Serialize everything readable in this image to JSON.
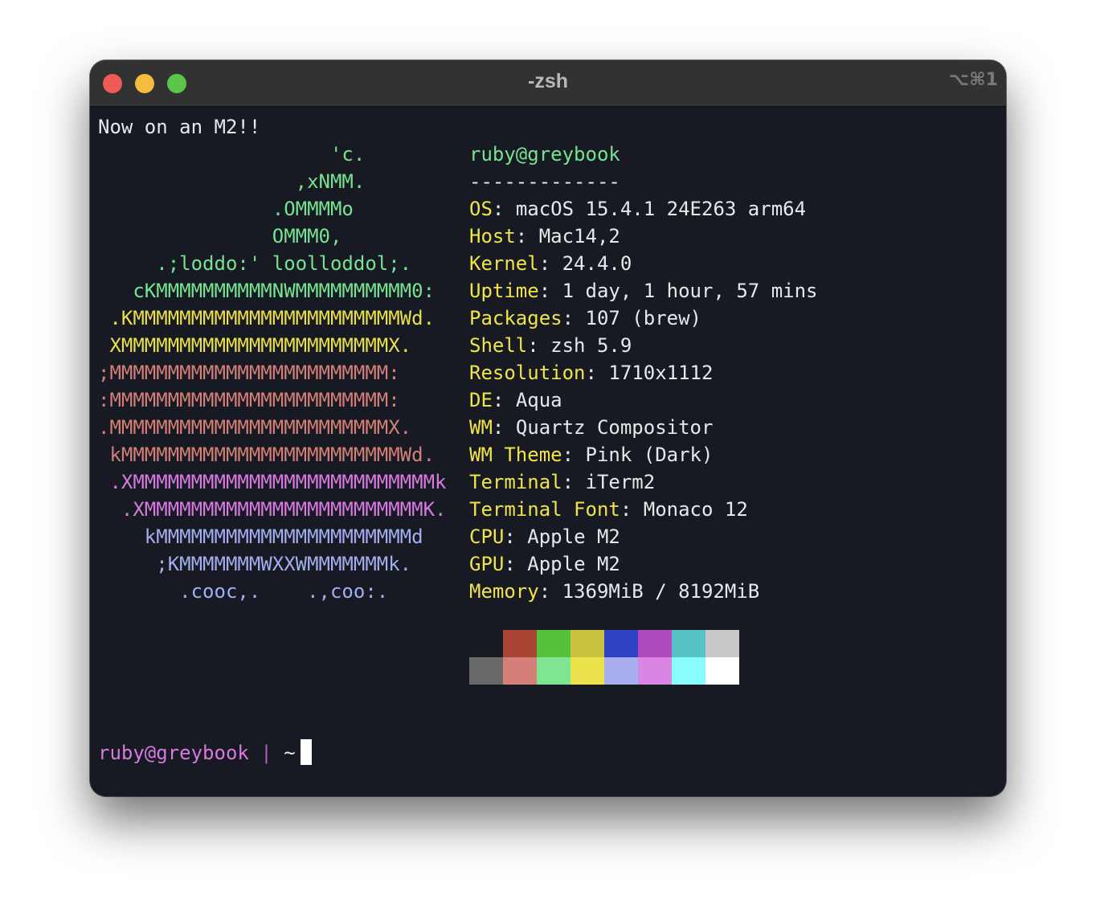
{
  "window": {
    "title": "-zsh",
    "shortcut": "⌥⌘1"
  },
  "motd": "Now on an M2!!",
  "logo": [
    {
      "text": "                    'c.",
      "color": "green"
    },
    {
      "text": "                 ,xNMM.",
      "color": "green"
    },
    {
      "text": "               .OMMMMo",
      "color": "green"
    },
    {
      "text": "               OMMM0,",
      "color": "green"
    },
    {
      "text": "     .;loddo:' loolloddol;.",
      "color": "green"
    },
    {
      "text": "   cKMMMMMMMMMMNWMMMMMMMMMM0:",
      "color": "green"
    },
    {
      "text": " .KMMMMMMMMMMMMMMMMMMMMMMMWd.",
      "color": "yellow"
    },
    {
      "text": " XMMMMMMMMMMMMMMMMMMMMMMMX.",
      "color": "yellow"
    },
    {
      "text": ";MMMMMMMMMMMMMMMMMMMMMMMM:",
      "color": "red"
    },
    {
      "text": ":MMMMMMMMMMMMMMMMMMMMMMMM:",
      "color": "red"
    },
    {
      "text": ".MMMMMMMMMMMMMMMMMMMMMMMMX.",
      "color": "red"
    },
    {
      "text": " kMMMMMMMMMMMMMMMMMMMMMMMMWd.",
      "color": "red"
    },
    {
      "text": " .XMMMMMMMMMMMMMMMMMMMMMMMMMMk",
      "color": "magenta"
    },
    {
      "text": "  .XMMMMMMMMMMMMMMMMMMMMMMMMK.",
      "color": "magenta"
    },
    {
      "text": "    kMMMMMMMMMMMMMMMMMMMMMMd",
      "color": "blue"
    },
    {
      "text": "     ;KMMMMMMMWXXWMMMMMMMk.",
      "color": "blue"
    },
    {
      "text": "       .cooc,.    .,coo:.",
      "color": "blue"
    }
  ],
  "info": {
    "user_host": "ruby@greybook",
    "divider": "-------------",
    "fields": [
      {
        "key": "OS",
        "value": "macOS 15.4.1 24E263 arm64"
      },
      {
        "key": "Host",
        "value": "Mac14,2"
      },
      {
        "key": "Kernel",
        "value": "24.4.0"
      },
      {
        "key": "Uptime",
        "value": "1 day, 1 hour, 57 mins"
      },
      {
        "key": "Packages",
        "value": "107 (brew)"
      },
      {
        "key": "Shell",
        "value": "zsh 5.9"
      },
      {
        "key": "Resolution",
        "value": "1710x1112"
      },
      {
        "key": "DE",
        "value": "Aqua"
      },
      {
        "key": "WM",
        "value": "Quartz Compositor"
      },
      {
        "key": "WM Theme",
        "value": "Pink (Dark)"
      },
      {
        "key": "Terminal",
        "value": "iTerm2"
      },
      {
        "key": "Terminal Font",
        "value": "Monaco 12"
      },
      {
        "key": "CPU",
        "value": "Apple M2"
      },
      {
        "key": "GPU",
        "value": "Apple M2"
      },
      {
        "key": "Memory",
        "value": "1369MiB / 8192MiB"
      }
    ]
  },
  "palette": {
    "normal": [
      "#171a22",
      "#a94535",
      "#57c13b",
      "#c8c43d",
      "#2e43c4",
      "#b04bbd",
      "#57c2c6",
      "#c9c9c9"
    ],
    "bright": [
      "#686868",
      "#d47f77",
      "#80e593",
      "#eae14b",
      "#a9aeee",
      "#d985e3",
      "#8afdfe",
      "#ffffff"
    ]
  },
  "colors": {
    "green": "#77e291",
    "yellow": "#eadf4e",
    "red": "#d47f77",
    "magenta": "#d77ae0",
    "blue": "#a3aef0"
  },
  "prompt": {
    "user": "ruby",
    "at": "@",
    "host": "greybook",
    "separator": " | ",
    "cwd": "~"
  }
}
